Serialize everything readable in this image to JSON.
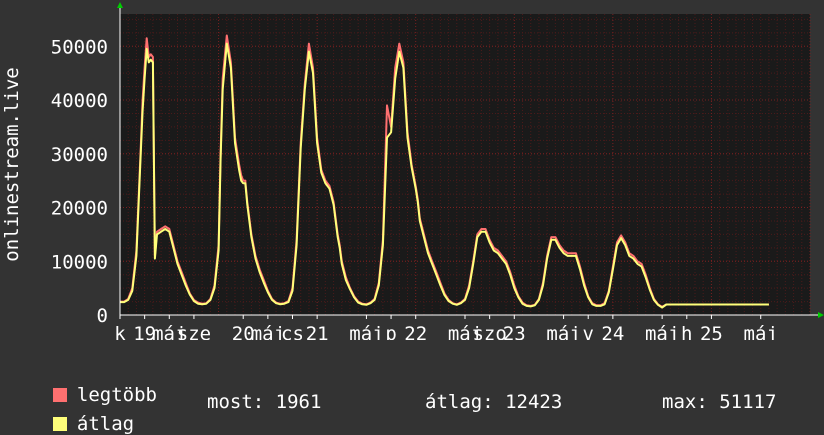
{
  "chart_data": {
    "type": "line",
    "ylabel": "onlinestream.live",
    "ylim": [
      0,
      56000
    ],
    "yticks": [
      0,
      10000,
      20000,
      30000,
      40000,
      50000
    ],
    "xlim": [
      0,
      168
    ],
    "x_tick_labels": [
      {
        "x": 0,
        "label": "k"
      },
      {
        "x": 6,
        "label": "19"
      },
      {
        "x": 12,
        "label": "máj"
      },
      {
        "x": 18,
        "label": "sze"
      },
      {
        "x": 30,
        "label": "20"
      },
      {
        "x": 36,
        "label": "máj"
      },
      {
        "x": 42,
        "label": "cs"
      },
      {
        "x": 48,
        "label": "21"
      },
      {
        "x": 60,
        "label": "máj"
      },
      {
        "x": 66,
        "label": "p"
      },
      {
        "x": 72,
        "label": "22"
      },
      {
        "x": 84,
        "label": "máj"
      },
      {
        "x": 90,
        "label": "szo"
      },
      {
        "x": 96,
        "label": "23"
      },
      {
        "x": 108,
        "label": "máj"
      },
      {
        "x": 114,
        "label": "v"
      },
      {
        "x": 120,
        "label": "24"
      },
      {
        "x": 132,
        "label": "máj"
      },
      {
        "x": 138,
        "label": "h"
      },
      {
        "x": 144,
        "label": "25"
      },
      {
        "x": 156,
        "label": "máj"
      }
    ],
    "x": [
      0,
      1,
      2,
      3,
      4,
      5,
      5.5,
      6,
      6.5,
      7,
      7.5,
      8,
      8.5,
      9,
      10,
      11,
      12,
      13,
      14,
      15,
      16,
      17,
      18,
      19,
      20,
      21,
      22,
      23,
      24,
      24.5,
      25,
      26,
      27,
      28,
      29,
      29.5,
      30,
      30.5,
      31,
      32,
      33,
      34,
      35,
      36,
      37,
      38,
      39,
      40,
      41,
      42,
      43,
      44,
      45,
      46,
      47,
      48,
      49,
      50,
      51,
      52,
      53,
      53.5,
      54,
      55,
      56,
      57,
      58,
      59,
      60,
      61,
      62,
      63,
      64,
      65,
      66,
      67,
      68,
      69,
      70,
      71,
      72,
      72.5,
      73,
      74,
      75,
      76,
      77,
      78,
      79,
      80,
      81,
      82,
      83,
      84,
      85,
      86,
      87,
      88,
      89,
      90,
      91,
      92,
      93,
      94,
      95,
      96,
      97,
      98,
      99,
      100,
      101,
      102,
      103,
      104,
      105,
      106,
      107,
      108,
      109,
      110,
      111,
      112,
      113,
      114,
      115,
      116,
      117,
      118,
      119,
      120,
      121,
      122,
      123,
      124,
      125,
      126,
      127,
      128,
      129,
      130,
      131,
      132,
      133,
      134,
      135,
      136,
      137,
      138,
      139,
      140,
      141,
      142,
      143,
      144,
      145,
      146,
      147,
      148,
      149,
      150,
      151,
      152,
      153,
      154,
      155,
      156,
      157,
      158,
      159,
      160,
      161,
      162,
      163,
      164,
      165,
      166,
      167,
      168
    ],
    "series": [
      {
        "name": "legtöbb",
        "color": "#ff7070",
        "values": [
          2500,
          2500,
          3000,
          5000,
          12000,
          30000,
          40000,
          46000,
          51500,
          48000,
          48500,
          48000,
          11000,
          15500,
          16000,
          16500,
          16000,
          13000,
          10000,
          8000,
          6000,
          4000,
          2800,
          2300,
          2100,
          2200,
          3000,
          5500,
          13000,
          30000,
          44000,
          52000,
          47000,
          33000,
          28000,
          26000,
          25000,
          25000,
          21000,
          15000,
          11000,
          8500,
          6500,
          4500,
          3000,
          2300,
          2100,
          2200,
          2600,
          5000,
          14000,
          32000,
          43000,
          50500,
          46000,
          33000,
          27000,
          25000,
          24000,
          21000,
          15000,
          13000,
          10000,
          7000,
          5000,
          3500,
          2500,
          2100,
          2000,
          2300,
          3000,
          6000,
          14000,
          39000,
          35000,
          46000,
          50500,
          47000,
          34000,
          28000,
          24000,
          21500,
          18000,
          15000,
          12000,
          10000,
          8000,
          6000,
          4000,
          2800,
          2200,
          2000,
          2300,
          3000,
          5500,
          10000,
          15000,
          16000,
          16000,
          14000,
          12500,
          12000,
          11000,
          10000,
          8000,
          5500,
          3500,
          2300,
          1800,
          1700,
          1900,
          3000,
          6000,
          11000,
          14500,
          14500,
          13000,
          12000,
          11500,
          11500,
          11500,
          9000,
          6000,
          3500,
          2200,
          1800,
          1800,
          2200,
          4500,
          9000,
          13500,
          14800,
          13500,
          11500,
          11000,
          10000,
          9500,
          7500,
          5000,
          3000,
          2000,
          1500,
          1961,
          1961,
          1961,
          1961,
          1961,
          1961,
          1961,
          1961,
          1961,
          1961,
          1961,
          1961,
          1961,
          1961,
          1961,
          1961,
          1961,
          1961,
          1961,
          1961,
          1961,
          1961,
          1961,
          1961,
          1961,
          1961
        ]
      },
      {
        "name": "átlag",
        "color": "#ffff7a",
        "values": [
          2400,
          2400,
          2800,
          4500,
          11000,
          29000,
          38000,
          44000,
          49500,
          47000,
          47500,
          47000,
          10500,
          15000,
          15500,
          16000,
          15500,
          12500,
          9500,
          7500,
          5500,
          3800,
          2600,
          2100,
          2000,
          2100,
          2800,
          5000,
          12000,
          29000,
          42000,
          50500,
          46000,
          32000,
          27000,
          25000,
          24500,
          24500,
          20500,
          14500,
          10500,
          8000,
          6000,
          4200,
          2800,
          2200,
          2000,
          2100,
          2400,
          4500,
          13000,
          31000,
          42000,
          49000,
          45000,
          32000,
          26500,
          24500,
          23500,
          20500,
          14500,
          12500,
          9500,
          6500,
          4800,
          3300,
          2300,
          2000,
          1900,
          2200,
          2800,
          5500,
          13000,
          33000,
          34000,
          44000,
          49000,
          46000,
          33000,
          27500,
          23500,
          21000,
          17500,
          14500,
          11500,
          9500,
          7500,
          5500,
          3700,
          2600,
          2100,
          1900,
          2200,
          2800,
          5000,
          9500,
          14500,
          15500,
          15500,
          13500,
          12000,
          11500,
          10500,
          9500,
          7500,
          5000,
          3300,
          2100,
          1700,
          1600,
          1800,
          2800,
          5500,
          10500,
          14000,
          14000,
          12500,
          11500,
          11000,
          11000,
          11000,
          8500,
          5500,
          3300,
          2000,
          1700,
          1700,
          2000,
          4200,
          8500,
          13000,
          14300,
          13000,
          11000,
          10500,
          9500,
          9000,
          7000,
          4700,
          2800,
          1900,
          1400,
          1961,
          1961,
          1961,
          1961,
          1961,
          1961,
          1961,
          1961,
          1961,
          1961,
          1961,
          1961,
          1961,
          1961,
          1961,
          1961,
          1961,
          1961,
          1961,
          1961,
          1961,
          1961,
          1961,
          1961,
          1961,
          1961
        ]
      }
    ]
  },
  "legend": {
    "max_label": "legtöbb",
    "max_color": "#ff7070",
    "avg_label": "átlag",
    "avg_color": "#ffff7a"
  },
  "stats": {
    "now": "most: 1961",
    "avg": "átlag: 12423",
    "max": "max: 51117"
  },
  "colors": {
    "background": "#333333",
    "plot_background": "#1a1a1a",
    "grid": "#7a2020",
    "axis": "#ffffff",
    "arrow": "#00cc00"
  }
}
